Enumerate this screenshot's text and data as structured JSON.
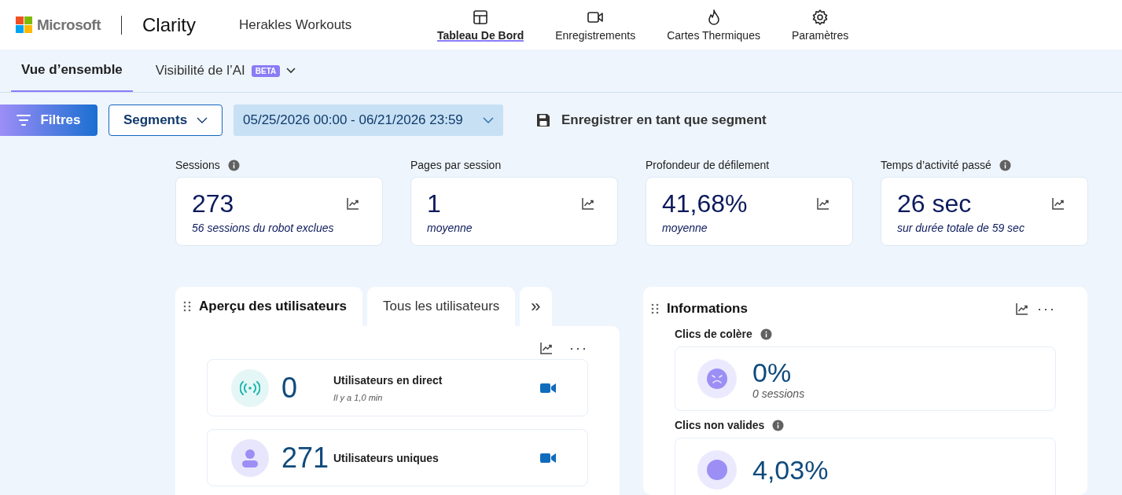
{
  "header": {
    "brand": {
      "company": "Microsoft",
      "product": "Clarity"
    },
    "project": "Herakles Workouts",
    "nav": [
      {
        "label": "Tableau De Bord",
        "kind": "dashboard",
        "selected": true
      },
      {
        "label": "Enregistrements",
        "kind": "video",
        "selected": false
      },
      {
        "label": "Cartes Thermiques",
        "kind": "flame",
        "selected": false
      },
      {
        "label": "Paramètres",
        "kind": "gear",
        "selected": false
      }
    ]
  },
  "subnav": {
    "tabs": [
      {
        "label": "Vue d’ensemble",
        "selected": true
      },
      {
        "label": "Visibilité de l’AI",
        "badge": "BETA",
        "dropdown": true,
        "selected": false
      }
    ]
  },
  "toolbar": {
    "filters": "Filtres",
    "segments": "Segments",
    "date_range": "05/25/2026 00:00 - 06/21/2026 23:59",
    "save_segment": "Enregistrer en tant que segment"
  },
  "metrics": [
    {
      "label": "Sessions",
      "info": true,
      "value": "273",
      "note": "56 sessions du robot exclues"
    },
    {
      "label": "Pages par session",
      "info": false,
      "value": "1",
      "note": "moyenne"
    },
    {
      "label": "Profondeur de défilement",
      "info": false,
      "value": "41,68%",
      "note": "moyenne"
    },
    {
      "label": "Temps d’activité passé",
      "info": true,
      "value": "26 sec",
      "note": "sur durée totale de 59 sec"
    }
  ],
  "users_panel": {
    "tabs": [
      {
        "label": "Aperçu des utilisateurs",
        "selected": true
      },
      {
        "label": "Tous les utilisateurs",
        "selected": false
      }
    ],
    "more_tabs": "»",
    "more_options": "···",
    "rows": [
      {
        "kind": "live",
        "value": "0",
        "label": "Utilisateurs en direct",
        "note": "Il y a 1,0 min"
      },
      {
        "kind": "unique",
        "value": "271",
        "label": "Utilisateurs uniques"
      }
    ]
  },
  "insights": {
    "title": "Informations",
    "more_options": "···",
    "items": [
      {
        "kind": "rage",
        "label": "Clics de colère",
        "value": "0%",
        "note": "0 sessions"
      },
      {
        "kind": "dead",
        "label": "Clics non valides",
        "value": "4,03%"
      }
    ]
  }
}
